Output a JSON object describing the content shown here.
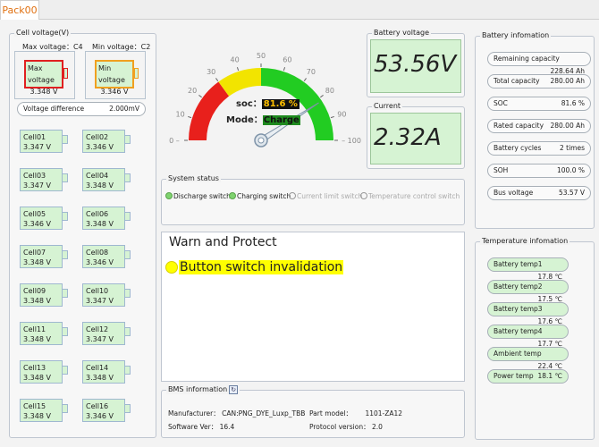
{
  "tab": "Pack00",
  "cell_panel": {
    "title": "Cell voltage(V)",
    "max_label": "Max voltage：C4",
    "min_label": "Min voltage：C2",
    "max_box_label": "Max voltage",
    "max_box_value": "3.348 V",
    "min_box_label": "Min voltage",
    "min_box_value": "3.346 V",
    "diff_label": "Voltage difference",
    "diff_value": "2.000mV",
    "cells": [
      {
        "name": "Cell01",
        "value": "3.347 V"
      },
      {
        "name": "Cell02",
        "value": "3.346 V"
      },
      {
        "name": "Cell03",
        "value": "3.347 V"
      },
      {
        "name": "Cell04",
        "value": "3.348 V"
      },
      {
        "name": "Cell05",
        "value": "3.346 V"
      },
      {
        "name": "Cell06",
        "value": "3.348 V"
      },
      {
        "name": "Cell07",
        "value": "3.348 V"
      },
      {
        "name": "Cell08",
        "value": "3.346 V"
      },
      {
        "name": "Cell09",
        "value": "3.348 V"
      },
      {
        "name": "Cell10",
        "value": "3.347 V"
      },
      {
        "name": "Cell11",
        "value": "3.348 V"
      },
      {
        "name": "Cell12",
        "value": "3.347 V"
      },
      {
        "name": "Cell13",
        "value": "3.348 V"
      },
      {
        "name": "Cell14",
        "value": "3.348 V"
      },
      {
        "name": "Cell15",
        "value": "3.348 V"
      },
      {
        "name": "Cell16",
        "value": "3.346 V"
      }
    ]
  },
  "gauge": {
    "ticks": [
      "0",
      "10",
      "20",
      "30",
      "40",
      "50",
      "60",
      "70",
      "80",
      "90",
      "100"
    ],
    "soc_label": "soc：",
    "soc_value": "81.6 %",
    "soc_percent": 81.6,
    "mode_label": "Mode：",
    "mode_value": "Charge"
  },
  "battery_voltage": {
    "title": "Battery voltage",
    "value": "53.56V"
  },
  "current": {
    "title": "Current",
    "value": "2.32A"
  },
  "system_status": {
    "title": "System status",
    "switches": [
      {
        "label": "Discharge switch",
        "on": true
      },
      {
        "label": "Charging switch",
        "on": true
      },
      {
        "label": "Current limit switch",
        "on": false
      },
      {
        "label": "Temperature control switch",
        "on": false
      }
    ]
  },
  "warn": {
    "title": "Warn and Protect",
    "message": "Button switch invalidation"
  },
  "bms": {
    "title": "BMS information",
    "manufacturer_label": "Manufacturer：",
    "manufacturer_value": "CAN:PNG_DYE_Luxp_TBB",
    "software_label": "Software Ver：",
    "software_value": "16.4",
    "part_label": "Part model：",
    "part_value": "1101-ZA12",
    "protocol_label": "Protocol version：",
    "protocol_value": "2.0"
  },
  "battery_info": {
    "title": "Battery infomation",
    "items": [
      {
        "label": "Remaining capacity",
        "value": "228.64 Ah"
      },
      {
        "label": "Total capacity",
        "value": "280.00 Ah"
      },
      {
        "label": "SOC",
        "value": "81.6 %"
      },
      {
        "label": "Rated capacity",
        "value": "280.00 Ah"
      },
      {
        "label": "Battery cycles",
        "value": "2 times"
      },
      {
        "label": "SOH",
        "value": "100.0 %"
      },
      {
        "label": "Bus voltage",
        "value": "53.57 V"
      }
    ]
  },
  "temperature_info": {
    "title": "Temperature infomation",
    "items": [
      {
        "label": "Battery temp1",
        "value": "17.8 ℃"
      },
      {
        "label": "Battery temp2",
        "value": "17.5 ℃"
      },
      {
        "label": "Battery temp3",
        "value": "17.6 ℃"
      },
      {
        "label": "Battery temp4",
        "value": "17.7 ℃"
      },
      {
        "label": "Ambient temp",
        "value": "22.4 ℃"
      },
      {
        "label": "Power temp",
        "value": "18.1 ℃"
      }
    ]
  },
  "colors": {
    "accent_orange": "#e07010",
    "cell_green": "#d6f3d3",
    "warn_yellow": "#ffff00",
    "gauge_red": "#e8201c",
    "gauge_yellow": "#f2e400",
    "gauge_green": "#22cc22"
  }
}
